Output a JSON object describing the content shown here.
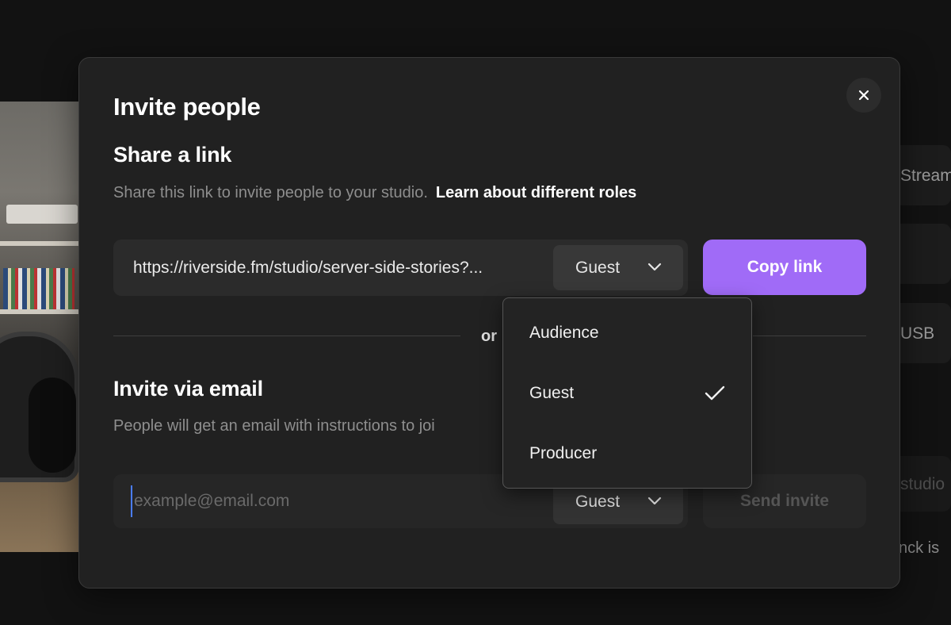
{
  "background": {
    "panels": [
      "Stream",
      "",
      "USB",
      "studio"
    ],
    "footer_text": "nck is"
  },
  "modal": {
    "title": "Invite people",
    "close_icon": "close-icon",
    "share": {
      "heading": "Share a link",
      "description": "Share this link to invite people to your studio.",
      "learn_link": "Learn about different roles",
      "link_value": "https://riverside.fm/studio/server-side-stories?...",
      "role_value": "Guest",
      "copy_label": "Copy link"
    },
    "divider_text": "or",
    "email": {
      "heading": "Invite via email",
      "description": "People will get an email with instructions to joi",
      "placeholder": "example@email.com",
      "role_value": "Guest",
      "send_label": "Send invite"
    }
  },
  "role_menu": {
    "items": [
      {
        "label": "Audience",
        "selected": false
      },
      {
        "label": "Guest",
        "selected": true
      },
      {
        "label": "Producer",
        "selected": false
      }
    ]
  },
  "colors": {
    "accent": "#a06bf7",
    "modal_bg": "#212121",
    "page_bg": "#121212"
  }
}
